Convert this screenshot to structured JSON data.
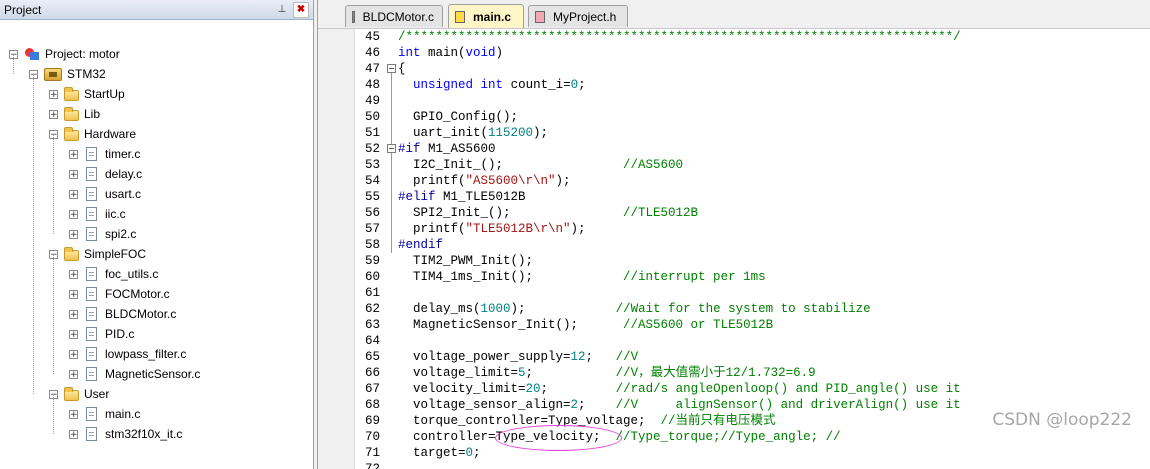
{
  "panel": {
    "title": "Project",
    "pin_glyph": "⊥",
    "close_glyph": "✖"
  },
  "tree": [
    {
      "label": "Project: motor",
      "type": "project",
      "expanded": true,
      "icon": "project-icon"
    },
    {
      "label": "STM32",
      "type": "target",
      "expanded": true,
      "icon": "target-icon"
    },
    {
      "label": "StartUp",
      "type": "group",
      "expanded": false,
      "icon": "folder-icon"
    },
    {
      "label": "Lib",
      "type": "group",
      "expanded": false,
      "icon": "folder-icon"
    },
    {
      "label": "Hardware",
      "type": "group",
      "expanded": true,
      "icon": "folder-open-icon"
    },
    {
      "label": "timer.c",
      "type": "file",
      "icon": "file-icon"
    },
    {
      "label": "delay.c",
      "type": "file",
      "icon": "file-icon"
    },
    {
      "label": "usart.c",
      "type": "file",
      "icon": "file-icon"
    },
    {
      "label": "iic.c",
      "type": "file",
      "icon": "file-icon"
    },
    {
      "label": "spi2.c",
      "type": "file",
      "icon": "file-icon"
    },
    {
      "label": "SimpleFOC",
      "type": "group",
      "expanded": true,
      "icon": "folder-open-icon"
    },
    {
      "label": "foc_utils.c",
      "type": "file",
      "icon": "file-icon"
    },
    {
      "label": "FOCMotor.c",
      "type": "file",
      "icon": "file-icon"
    },
    {
      "label": "BLDCMotor.c",
      "type": "file",
      "icon": "file-icon"
    },
    {
      "label": "PID.c",
      "type": "file",
      "icon": "file-icon"
    },
    {
      "label": "lowpass_filter.c",
      "type": "file",
      "icon": "file-icon"
    },
    {
      "label": "MagneticSensor.c",
      "type": "file",
      "icon": "file-icon"
    },
    {
      "label": "User",
      "type": "group",
      "expanded": true,
      "icon": "folder-open-icon"
    },
    {
      "label": "main.c",
      "type": "file",
      "icon": "file-icon"
    },
    {
      "label": "stm32f10x_it.c",
      "type": "file",
      "icon": "file-icon"
    }
  ],
  "tabs": [
    {
      "label": "BLDCMotor.c",
      "active": false,
      "icon_color": "#5fae5f"
    },
    {
      "label": "main.c",
      "active": true,
      "icon_color": "#ffd94a"
    },
    {
      "label": "MyProject.h",
      "active": false,
      "icon_color": "#f4a7b5"
    }
  ],
  "colors": {
    "keyword": "#0000ff",
    "number": "#008080",
    "string": "#a31515",
    "comment": "#008000",
    "preprocessor": "#0000a0",
    "highlight_circle": "#e53fd8"
  },
  "code_lines": [
    {
      "n": "45",
      "fold": "",
      "tokens": [
        [
          "cmt",
          "/*************************************************************************/"
        ]
      ]
    },
    {
      "n": "46",
      "fold": "",
      "tokens": [
        [
          "kw",
          "int"
        ],
        [
          "txt",
          " main("
        ],
        [
          "kw",
          "void"
        ],
        [
          "txt",
          ")"
        ]
      ]
    },
    {
      "n": "47",
      "fold": "-",
      "tokens": [
        [
          "txt",
          "{"
        ]
      ]
    },
    {
      "n": "48",
      "fold": "",
      "tokens": [
        [
          "txt",
          "  "
        ],
        [
          "kw",
          "unsigned"
        ],
        [
          "txt",
          " "
        ],
        [
          "kw",
          "int"
        ],
        [
          "txt",
          " count_i="
        ],
        [
          "num",
          "0"
        ],
        [
          "txt",
          ";"
        ]
      ]
    },
    {
      "n": "49",
      "fold": "",
      "tokens": []
    },
    {
      "n": "50",
      "fold": "",
      "tokens": [
        [
          "txt",
          "  GPIO_Config();"
        ]
      ]
    },
    {
      "n": "51",
      "fold": "",
      "tokens": [
        [
          "txt",
          "  uart_init("
        ],
        [
          "num",
          "115200"
        ],
        [
          "txt",
          ");"
        ]
      ]
    },
    {
      "n": "52",
      "fold": "-",
      "tokens": [
        [
          "pp",
          "#if"
        ],
        [
          "txt",
          " M1_AS5600"
        ]
      ]
    },
    {
      "n": "53",
      "fold": "",
      "tokens": [
        [
          "txt",
          "  I2C_Init_();                "
        ],
        [
          "cmt",
          "//AS5600"
        ]
      ]
    },
    {
      "n": "54",
      "fold": "",
      "tokens": [
        [
          "txt",
          "  printf("
        ],
        [
          "str",
          "\"AS5600\\r\\n\""
        ],
        [
          "txt",
          ");"
        ]
      ]
    },
    {
      "n": "55",
      "fold": "",
      "tokens": [
        [
          "pp",
          "#elif"
        ],
        [
          "txt",
          " M1_TLE5012B"
        ]
      ]
    },
    {
      "n": "56",
      "fold": "",
      "tokens": [
        [
          "txt",
          "  SPI2_Init_();               "
        ],
        [
          "cmt",
          "//TLE5012B"
        ]
      ]
    },
    {
      "n": "57",
      "fold": "",
      "tokens": [
        [
          "txt",
          "  printf("
        ],
        [
          "str",
          "\"TLE5012B\\r\\n\""
        ],
        [
          "txt",
          ");"
        ]
      ]
    },
    {
      "n": "58",
      "fold": "",
      "tokens": [
        [
          "pp",
          "#endif"
        ]
      ]
    },
    {
      "n": "59",
      "fold": "",
      "tokens": [
        [
          "txt",
          "  TIM2_PWM_Init();"
        ]
      ]
    },
    {
      "n": "60",
      "fold": "",
      "tokens": [
        [
          "txt",
          "  TIM4_1ms_Init();            "
        ],
        [
          "cmt",
          "//interrupt per 1ms"
        ]
      ]
    },
    {
      "n": "61",
      "fold": "",
      "tokens": []
    },
    {
      "n": "62",
      "fold": "",
      "tokens": [
        [
          "txt",
          "  delay_ms("
        ],
        [
          "num",
          "1000"
        ],
        [
          "txt",
          ");            "
        ],
        [
          "cmt",
          "//Wait for the system to stabilize"
        ]
      ]
    },
    {
      "n": "63",
      "fold": "",
      "tokens": [
        [
          "txt",
          "  MagneticSensor_Init();      "
        ],
        [
          "cmt",
          "//AS5600 or TLE5012B"
        ]
      ]
    },
    {
      "n": "64",
      "fold": "",
      "tokens": []
    },
    {
      "n": "65",
      "fold": "",
      "tokens": [
        [
          "txt",
          "  voltage_power_supply="
        ],
        [
          "num",
          "12"
        ],
        [
          "txt",
          ";   "
        ],
        [
          "cmt",
          "//V"
        ]
      ]
    },
    {
      "n": "66",
      "fold": "",
      "tokens": [
        [
          "txt",
          "  voltage_limit="
        ],
        [
          "num",
          "5"
        ],
        [
          "txt",
          ";           "
        ],
        [
          "cmt",
          "//V，最大值需小于12/1.732=6.9"
        ]
      ]
    },
    {
      "n": "67",
      "fold": "",
      "tokens": [
        [
          "txt",
          "  velocity_limit="
        ],
        [
          "num",
          "20"
        ],
        [
          "txt",
          ";         "
        ],
        [
          "cmt",
          "//rad/s angleOpenloop() and PID_angle() use it"
        ]
      ]
    },
    {
      "n": "68",
      "fold": "",
      "tokens": [
        [
          "txt",
          "  voltage_sensor_align="
        ],
        [
          "num",
          "2"
        ],
        [
          "txt",
          ";    "
        ],
        [
          "cmt",
          "//V     alignSensor() and driverAlign() use it"
        ]
      ]
    },
    {
      "n": "69",
      "fold": "",
      "tokens": [
        [
          "txt",
          "  torque_controller=Type_voltage;  "
        ],
        [
          "cmt",
          "//当前只有电压模式"
        ]
      ]
    },
    {
      "n": "70",
      "fold": "",
      "tokens": [
        [
          "txt",
          "  controller=Type_velocity;  "
        ],
        [
          "cmt",
          "//Type_torque;//Type_angle; //"
        ]
      ]
    },
    {
      "n": "71",
      "fold": "",
      "tokens": [
        [
          "txt",
          "  target="
        ],
        [
          "num",
          "0"
        ],
        [
          "txt",
          ";"
        ]
      ]
    },
    {
      "n": "72",
      "fold": "",
      "tokens": []
    }
  ],
  "watermark": "CSDN @loop222"
}
